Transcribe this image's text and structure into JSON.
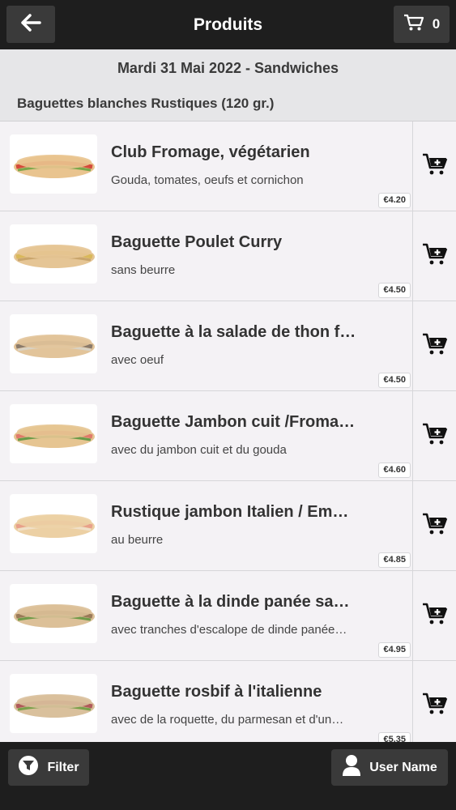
{
  "header": {
    "title": "Produits",
    "cart_count": "0"
  },
  "subheader": {
    "date_line": "Mardi 31 Mai 2022 - Sandwiches",
    "category": "Baguettes blanches Rustiques (120 gr.)"
  },
  "products": [
    {
      "name": "Club Fromage, végétarien",
      "description": "Gouda, tomates, oeufs et cornichon",
      "price": "€4.20"
    },
    {
      "name": "Baguette Poulet Curry",
      "description": "sans beurre",
      "price": "€4.50"
    },
    {
      "name": "Baguette à la salade de thon f…",
      "description": "avec oeuf",
      "price": "€4.50"
    },
    {
      "name": "Baguette Jambon cuit /Froma…",
      "description": "avec du jambon cuit et du gouda",
      "price": "€4.60"
    },
    {
      "name": "Rustique jambon Italien / Em…",
      "description": "au beurre",
      "price": "€4.85"
    },
    {
      "name": "Baguette à la dinde panée sa…",
      "description": "avec tranches d'escalope de dinde panée…",
      "price": "€4.95"
    },
    {
      "name": "Baguette rosbif à l'italienne",
      "description": "avec de la roquette, du parmesan et d'un…",
      "price": "€5.35"
    }
  ],
  "footer": {
    "filter_label": "Filter",
    "user_label": "User Name"
  },
  "icons": {
    "back": "arrow-left-icon",
    "cart": "cart-icon",
    "add_to_cart": "add-to-cart-icon",
    "filter": "filter-icon",
    "user": "user-icon"
  }
}
